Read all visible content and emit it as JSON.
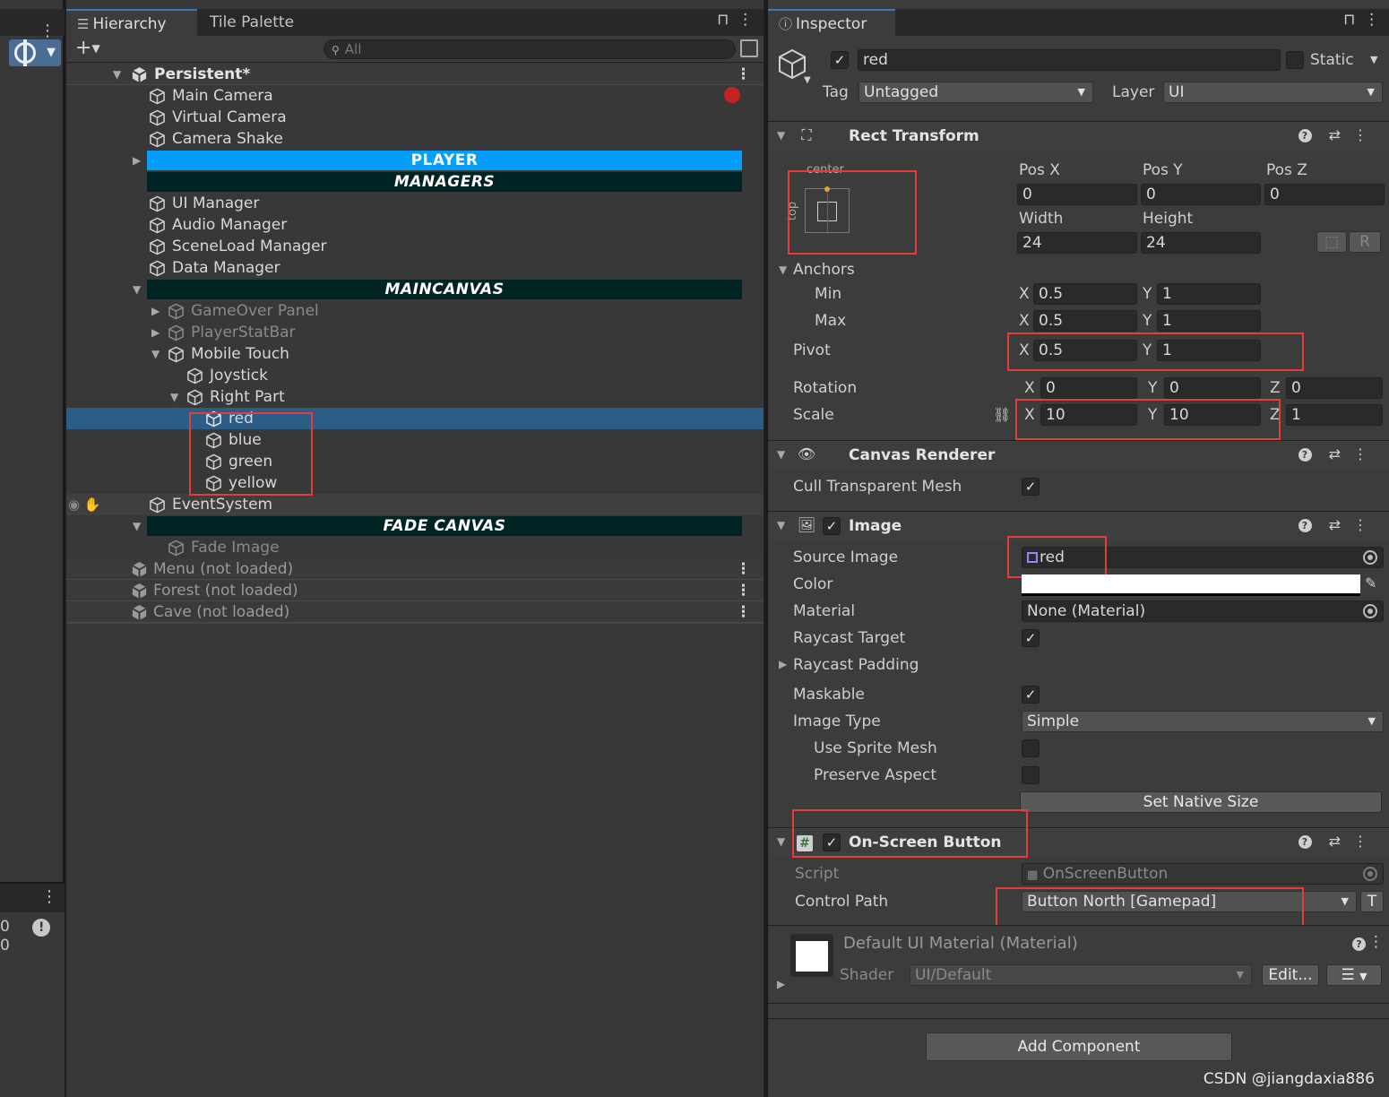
{
  "left_strip": {
    "menu_icon": "kebab-icon",
    "gizmo_icon": "move-gizmo-icon",
    "log_count": "0",
    "warning_count": "0"
  },
  "hierarchy": {
    "tabs": [
      {
        "label": "Hierarchy",
        "icon": "list-icon"
      },
      {
        "label": "Tile Palette"
      }
    ],
    "search_placeholder": "All",
    "rows": [
      {
        "label": "Persistent*",
        "kind": "scene"
      },
      {
        "label": "Main Camera",
        "kind": "object"
      },
      {
        "label": "Virtual Camera",
        "kind": "object"
      },
      {
        "label": "Camera Shake",
        "kind": "object"
      },
      {
        "label": "PLAYER",
        "kind": "banner-blue"
      },
      {
        "label": "MANAGERS",
        "kind": "banner-dark"
      },
      {
        "label": "UI Manager",
        "kind": "object"
      },
      {
        "label": "Audio Manager",
        "kind": "object"
      },
      {
        "label": "SceneLoad Manager",
        "kind": "object"
      },
      {
        "label": "Data Manager",
        "kind": "object"
      },
      {
        "label": "MAINCANVAS",
        "kind": "banner-dark"
      },
      {
        "label": "GameOver Panel",
        "kind": "disabled"
      },
      {
        "label": "PlayerStatBar",
        "kind": "disabled"
      },
      {
        "label": "Mobile Touch",
        "kind": "object"
      },
      {
        "label": "Joystick",
        "kind": "object"
      },
      {
        "label": "Right Part",
        "kind": "object"
      },
      {
        "label": "red",
        "kind": "selected"
      },
      {
        "label": "blue",
        "kind": "object"
      },
      {
        "label": "green",
        "kind": "object"
      },
      {
        "label": "yellow",
        "kind": "object"
      },
      {
        "label": "EventSystem",
        "kind": "object"
      },
      {
        "label": "FADE CANVAS",
        "kind": "banner-dark"
      },
      {
        "label": "Fade Image",
        "kind": "disabled"
      },
      {
        "label": "Menu (not loaded)",
        "kind": "unloaded"
      },
      {
        "label": "Forest (not loaded)",
        "kind": "unloaded"
      },
      {
        "label": "Cave (not loaded)",
        "kind": "unloaded"
      }
    ]
  },
  "inspector": {
    "tab_label": "Inspector",
    "object_name": "red",
    "static_label": "Static",
    "tag_label": "Tag",
    "tag_value": "Untagged",
    "layer_label": "Layer",
    "layer_value": "UI",
    "rect_transform": {
      "title": "Rect Transform",
      "anchor_preset_h": "center",
      "anchor_preset_v": "top",
      "pos_x_label": "Pos X",
      "pos_y_label": "Pos Y",
      "pos_z_label": "Pos Z",
      "pos_x": "0",
      "pos_y": "0",
      "pos_z": "0",
      "width_label": "Width",
      "height_label": "Height",
      "width": "24",
      "height": "24",
      "raw_edit_label": "R",
      "anchors_label": "Anchors",
      "min_label": "Min",
      "max_label": "Max",
      "anchor_min_x": "0.5",
      "anchor_min_y": "1",
      "anchor_max_x": "0.5",
      "anchor_max_y": "1",
      "pivot_label": "Pivot",
      "pivot_x": "0.5",
      "pivot_y": "1",
      "rotation_label": "Rotation",
      "rot_x": "0",
      "rot_y": "0",
      "rot_z": "0",
      "scale_label": "Scale",
      "scale_x": "10",
      "scale_y": "10",
      "scale_z": "1",
      "axis_x": "X",
      "axis_y": "Y",
      "axis_z": "Z"
    },
    "canvas_renderer": {
      "title": "Canvas Renderer",
      "cull_label": "Cull Transparent Mesh",
      "cull_checked": true
    },
    "image": {
      "title": "Image",
      "source_image_label": "Source Image",
      "source_image_value": "red",
      "color_label": "Color",
      "color_value": "#ffffff",
      "material_label": "Material",
      "material_value": "None (Material)",
      "raycast_target_label": "Raycast Target",
      "raycast_padding_label": "Raycast Padding",
      "maskable_label": "Maskable",
      "image_type_label": "Image Type",
      "image_type_value": "Simple",
      "use_sprite_mesh_label": "Use Sprite Mesh",
      "preserve_aspect_label": "Preserve Aspect",
      "set_native_size_label": "Set Native Size"
    },
    "on_screen_button": {
      "title": "On-Screen Button",
      "script_label": "Script",
      "script_value": "OnScreenButton",
      "control_path_label": "Control Path",
      "control_path_value": "Button North [Gamepad]",
      "t_button": "T"
    },
    "material_preview": {
      "title": "Default UI Material (Material)",
      "shader_label": "Shader",
      "shader_value": "UI/Default",
      "edit_label": "Edit..."
    },
    "add_component_label": "Add Component"
  },
  "watermark": "CSDN @jiangdaxia886",
  "colors": {
    "highlight_box": "#e53c3c",
    "selection": "#2c5d87",
    "player_banner": "#039dfc",
    "dark_banner": "#002324"
  }
}
